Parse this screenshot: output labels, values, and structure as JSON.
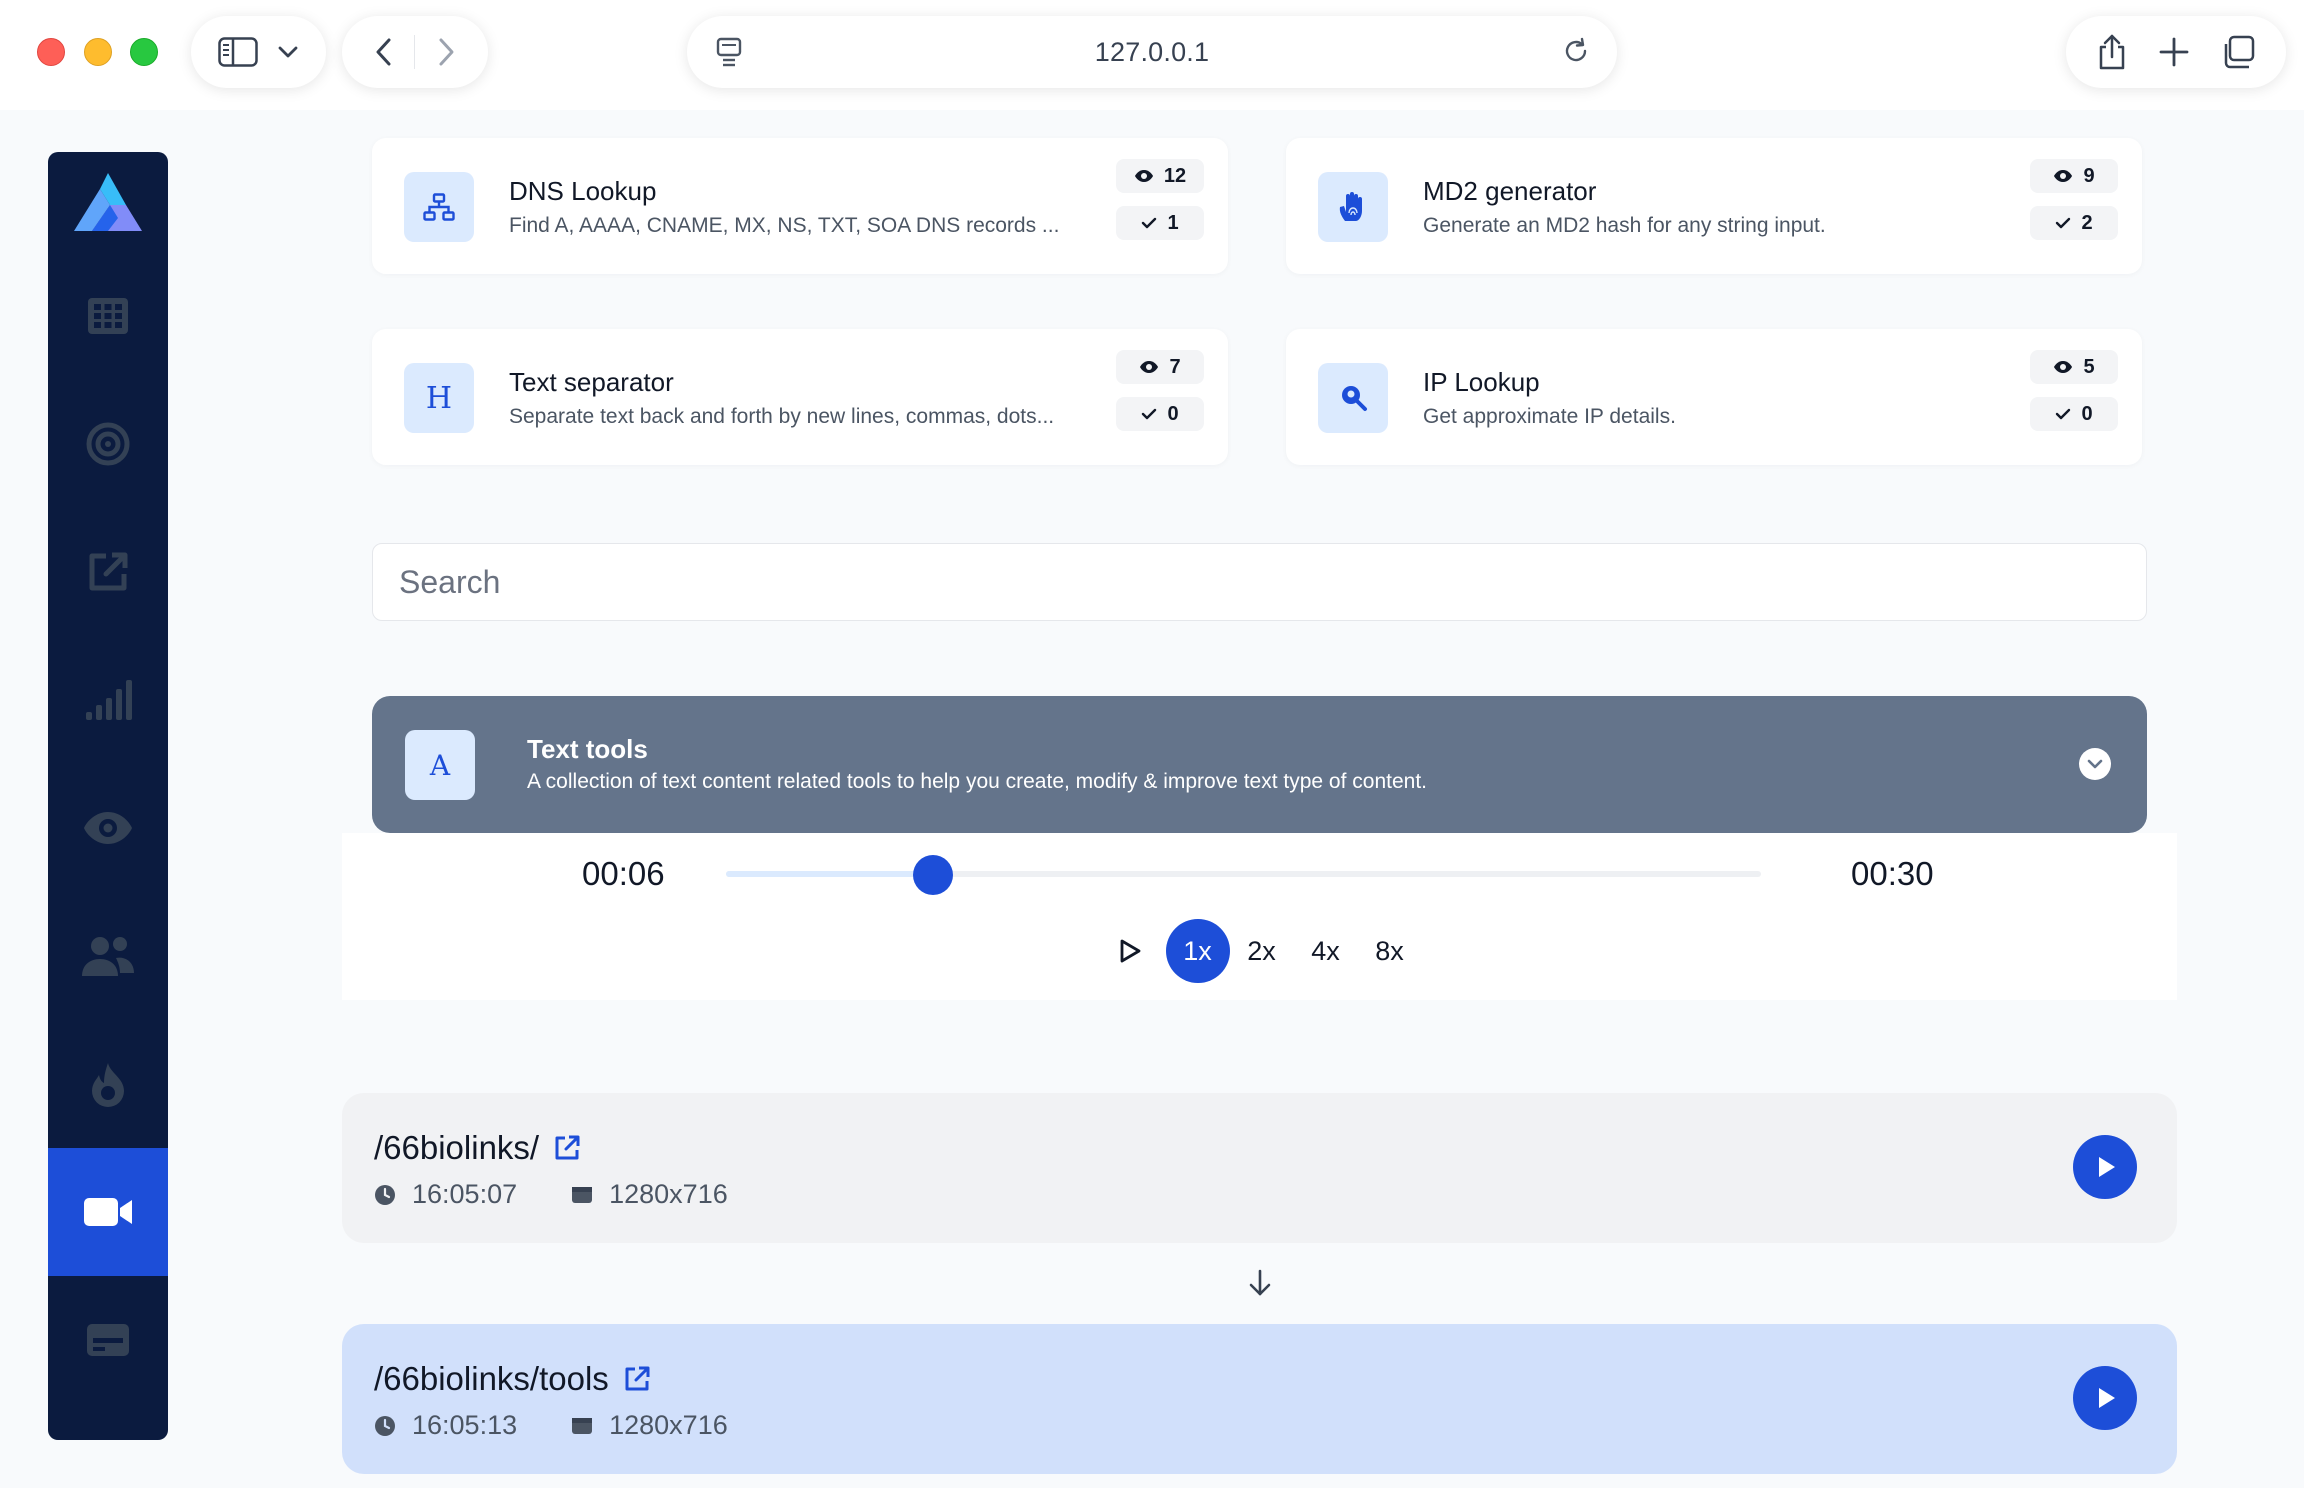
{
  "browser": {
    "url": "127.0.0.1"
  },
  "tool_cards": [
    {
      "title": "DNS Lookup",
      "description": "Find A, AAAA, CNAME, MX, NS, TXT, SOA DNS records ...",
      "views": "12",
      "completed": "1",
      "icon": "sitemap-icon"
    },
    {
      "title": "MD2 generator",
      "description": "Generate an MD2 hash for any string input.",
      "views": "9",
      "completed": "2",
      "icon": "fingerprint-hand-icon"
    },
    {
      "title": "Text separator",
      "description": "Separate text back and forth by new lines, commas, dots...",
      "views": "7",
      "completed": "0",
      "tile_letter": "H"
    },
    {
      "title": "IP Lookup",
      "description": "Get approximate IP details.",
      "views": "5",
      "completed": "0",
      "icon": "search-location-icon"
    }
  ],
  "search": {
    "placeholder": "Search"
  },
  "category": {
    "tile_letter": "A",
    "title": "Text tools",
    "description": "A collection of text content related tools to help you create, modify & improve text type of content."
  },
  "player": {
    "current_time": "00:06",
    "total_time": "00:30",
    "progress": 0.2,
    "speeds": [
      "1x",
      "2x",
      "4x",
      "8x"
    ],
    "active_speed": "1x"
  },
  "recordings": [
    {
      "path": "/66biolinks/",
      "time": "16:05:07",
      "resolution": "1280x716"
    },
    {
      "path": "/66biolinks/tools",
      "time": "16:05:13",
      "resolution": "1280x716"
    }
  ],
  "colors": {
    "sidebar": "#0b1b3f",
    "accent": "#1d4ed8",
    "banner": "#64748b",
    "active_row": "#d1e0fb"
  }
}
